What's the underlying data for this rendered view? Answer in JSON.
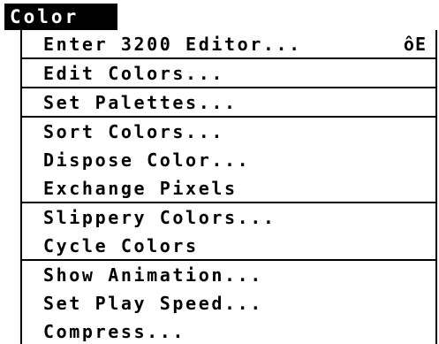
{
  "menu": {
    "title": "Color",
    "items": [
      {
        "label": "Enter 3200 Editor...",
        "shortcut": "ôE"
      },
      {
        "label": "Edit Colors..."
      },
      {
        "label": "Set Palettes..."
      },
      {
        "label": "Sort Colors..."
      },
      {
        "label": "Dispose Color..."
      },
      {
        "label": "Exchange Pixels"
      },
      {
        "label": "Slippery Colors..."
      },
      {
        "label": "Cycle Colors"
      },
      {
        "label": "Show Animation..."
      },
      {
        "label": "Set Play Speed..."
      },
      {
        "label": "Compress..."
      }
    ]
  }
}
